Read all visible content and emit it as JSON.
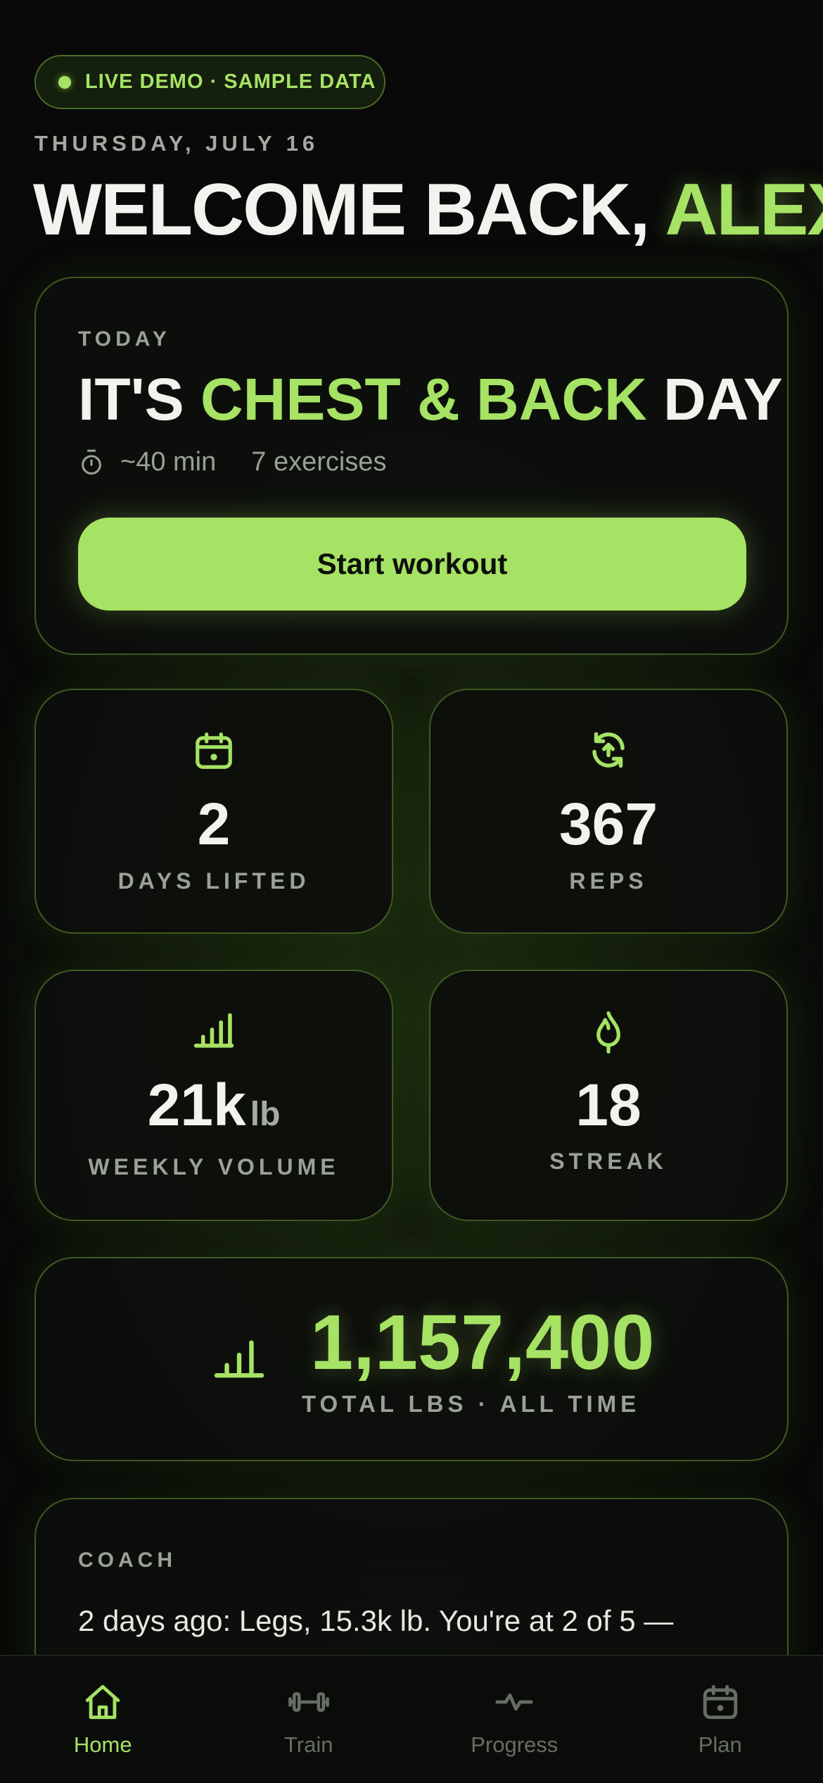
{
  "status_pill": {
    "text": "LIVE DEMO · SAMPLE DATA"
  },
  "header": {
    "date": "THURSDAY, JULY 16",
    "welcome_prefix": "WELCOME BACK, ",
    "user_name": "ALEX"
  },
  "today": {
    "label": "TODAY",
    "title_prefix": "IT'S ",
    "title_focus": "CHEST & BACK",
    "title_suffix": " DAY",
    "duration": "~40 min",
    "exercises": "7 exercises",
    "start_button": "Start workout"
  },
  "stats": [
    {
      "icon": "calendar-icon",
      "value": "2",
      "label": "DAYS LIFTED"
    },
    {
      "icon": "refresh-icon",
      "value": "367",
      "label": "REPS"
    },
    {
      "icon": "bar-chart-icon",
      "value": "21k",
      "unit": "lb",
      "label": "WEEKLY VOLUME"
    },
    {
      "icon": "flame-icon",
      "value": "18",
      "label": "STREAK"
    }
  ],
  "total": {
    "icon": "bar-chart-icon",
    "value": "1,157,400",
    "label": "TOTAL LBS · ALL TIME"
  },
  "coach": {
    "label": "COACH",
    "text": "2 days ago: Legs, 15.3k lb. You're at 2 of 5 —"
  },
  "tabbar": {
    "items": [
      {
        "label": "Home",
        "icon": "home-icon",
        "active": true
      },
      {
        "label": "Train",
        "icon": "dumbbell-icon",
        "active": false
      },
      {
        "label": "Progress",
        "icon": "activity-icon",
        "active": false
      },
      {
        "label": "Plan",
        "icon": "calendar-icon",
        "active": false
      }
    ]
  },
  "colors": {
    "accent": "#a6e264",
    "background": "#080908",
    "card_border": "#3e5a22",
    "muted_text": "#9ca198"
  }
}
